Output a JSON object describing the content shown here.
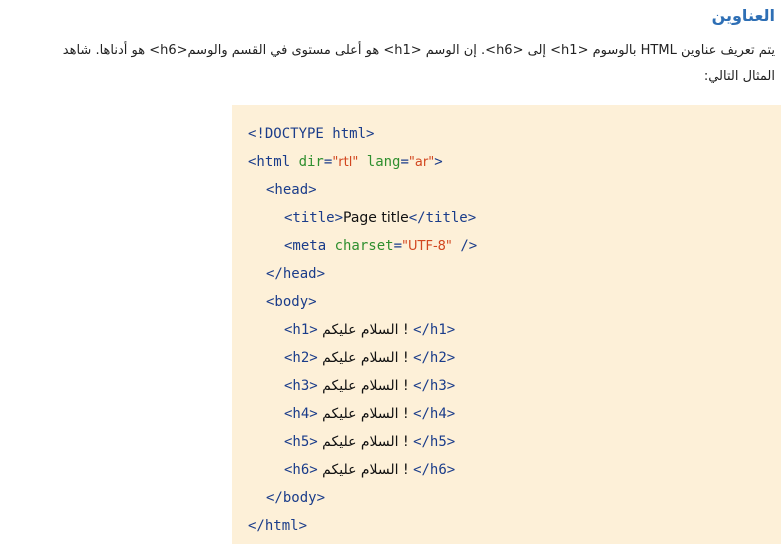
{
  "section": {
    "title": "العناوين",
    "intro_line1": "يتم تعريف عناوين HTML بالوسوم <h1> إلى <h6>. إن الوسم <h1> هو أعلى مستوى في القسم والوسم<h6> هو أدناها. شاهد",
    "intro_line2": "المثال التالي:"
  },
  "code": {
    "doctype": "<!DOCTYPE html>",
    "html_open_start": "<html ",
    "html_attr_dir": "dir",
    "html_attr_dir_val": "\"rtl\"",
    "html_attr_lang": "lang",
    "html_attr_lang_val": "\"ar\"",
    "html_open_end": ">",
    "head_open": "<head>",
    "title_open": "<title>",
    "title_text": "Page title",
    "title_close": "</title>",
    "meta_start": "<meta ",
    "meta_attr": "charset",
    "meta_val": "\"UTF-8\"",
    "meta_end": " />",
    "head_close": "</head>",
    "body_open": "<body>",
    "headings": [
      {
        "open": "<h1>",
        "text": " السلام عليكم ! ",
        "close": "</h1>"
      },
      {
        "open": "<h2>",
        "text": " السلام عليكم ! ",
        "close": "</h2>"
      },
      {
        "open": "<h3>",
        "text": " السلام عليكم ! ",
        "close": "</h3>"
      },
      {
        "open": "<h4>",
        "text": " السلام عليكم ! ",
        "close": "</h4>"
      },
      {
        "open": "<h5>",
        "text": " السلام عليكم ! ",
        "close": "</h5>"
      },
      {
        "open": "<h6>",
        "text": " السلام عليكم ! ",
        "close": "</h6>"
      }
    ],
    "body_close": "</body>",
    "html_close": "</html>"
  },
  "colors": {
    "heading": "#2e6fb5",
    "code_background": "#fdf0d8",
    "tag": "#1a3c8a",
    "attribute": "#2f8f2f",
    "value": "#d2461f"
  }
}
